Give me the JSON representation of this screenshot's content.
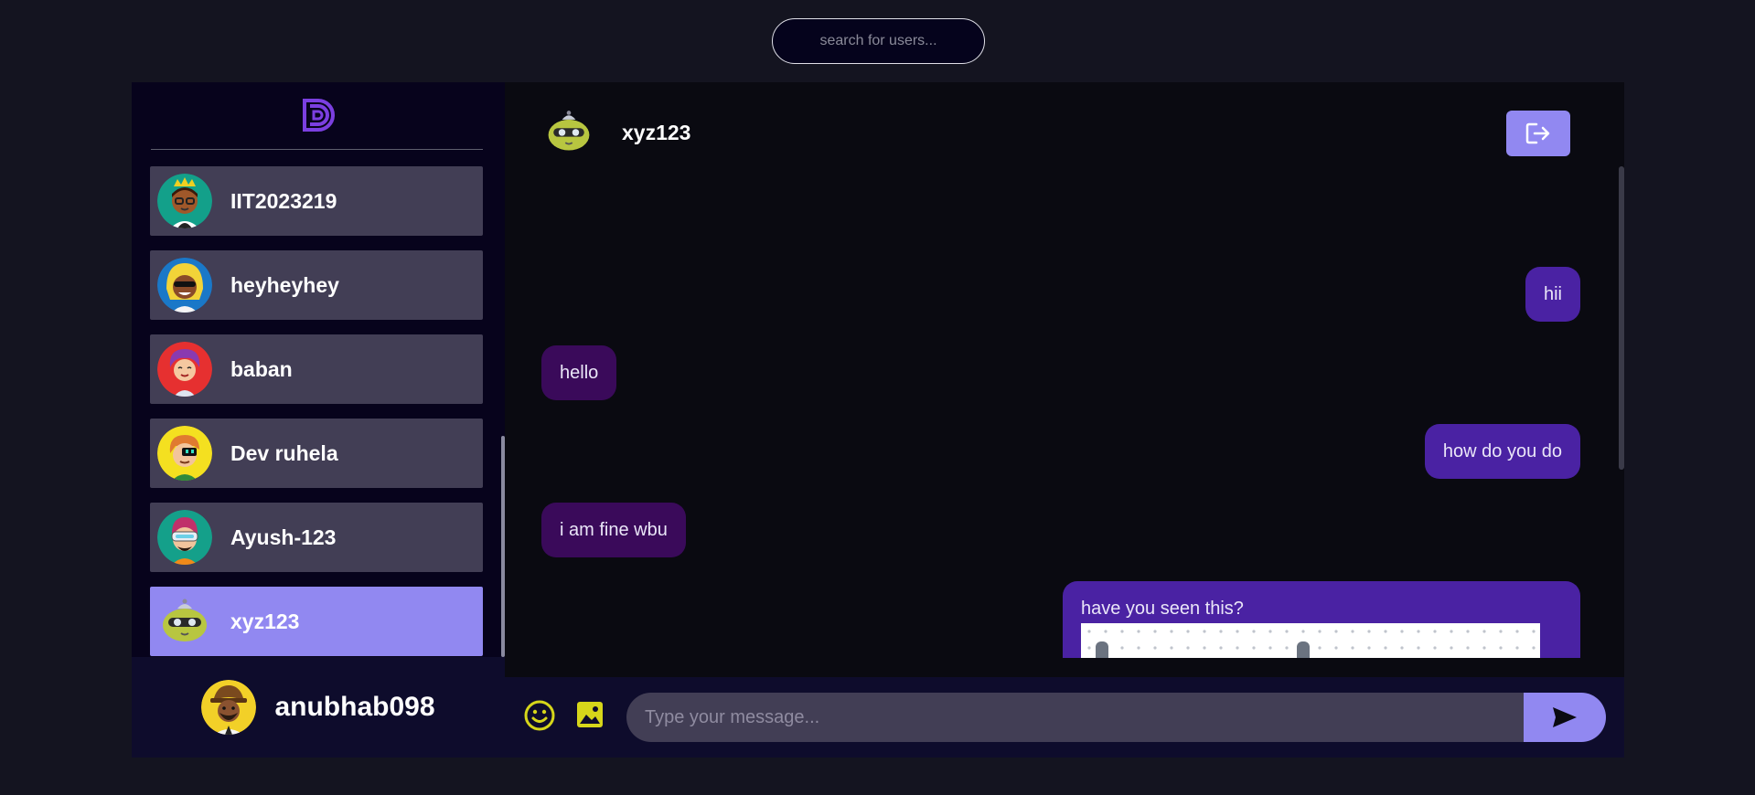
{
  "search": {
    "placeholder": "search for users..."
  },
  "sidebar": {
    "logo_icon": "brand-d-logo-icon",
    "contacts": [
      {
        "name": "IIT2023219",
        "avatar": "avatar-crowned-glasses",
        "active": false
      },
      {
        "name": "heyheyhey",
        "avatar": "avatar-blonde-sunglasses",
        "active": false
      },
      {
        "name": "baban",
        "avatar": "avatar-purple-hair",
        "active": false
      },
      {
        "name": "Dev ruhela",
        "avatar": "avatar-visor-ginger",
        "active": false
      },
      {
        "name": "Ayush-123",
        "avatar": "avatar-vr-headset",
        "active": false
      },
      {
        "name": "xyz123",
        "avatar": "avatar-robot-green",
        "active": true
      }
    ],
    "profile": {
      "name": "anubhab098",
      "avatar": "avatar-hat-beard"
    }
  },
  "chat": {
    "header": {
      "name": "xyz123",
      "avatar": "avatar-robot-green",
      "logout_icon": "logout-icon"
    },
    "messages": [
      {
        "direction": "out",
        "text": "hii"
      },
      {
        "direction": "in",
        "text": "hello"
      },
      {
        "direction": "out",
        "text": "how do you do"
      },
      {
        "direction": "in",
        "text": "i am fine wbu"
      },
      {
        "direction": "out",
        "text": "have you seen this?",
        "has_image": true
      }
    ],
    "input": {
      "placeholder": "Type your message...",
      "emoji_icon": "smiley-icon",
      "image_icon": "image-icon",
      "send_icon": "send-icon"
    }
  },
  "colors": {
    "accent": "#9188f1",
    "outgoing_bubble": "#4a22a3",
    "incoming_bubble": "#3a0a5a",
    "icon_yellow": "#d6d61a"
  }
}
